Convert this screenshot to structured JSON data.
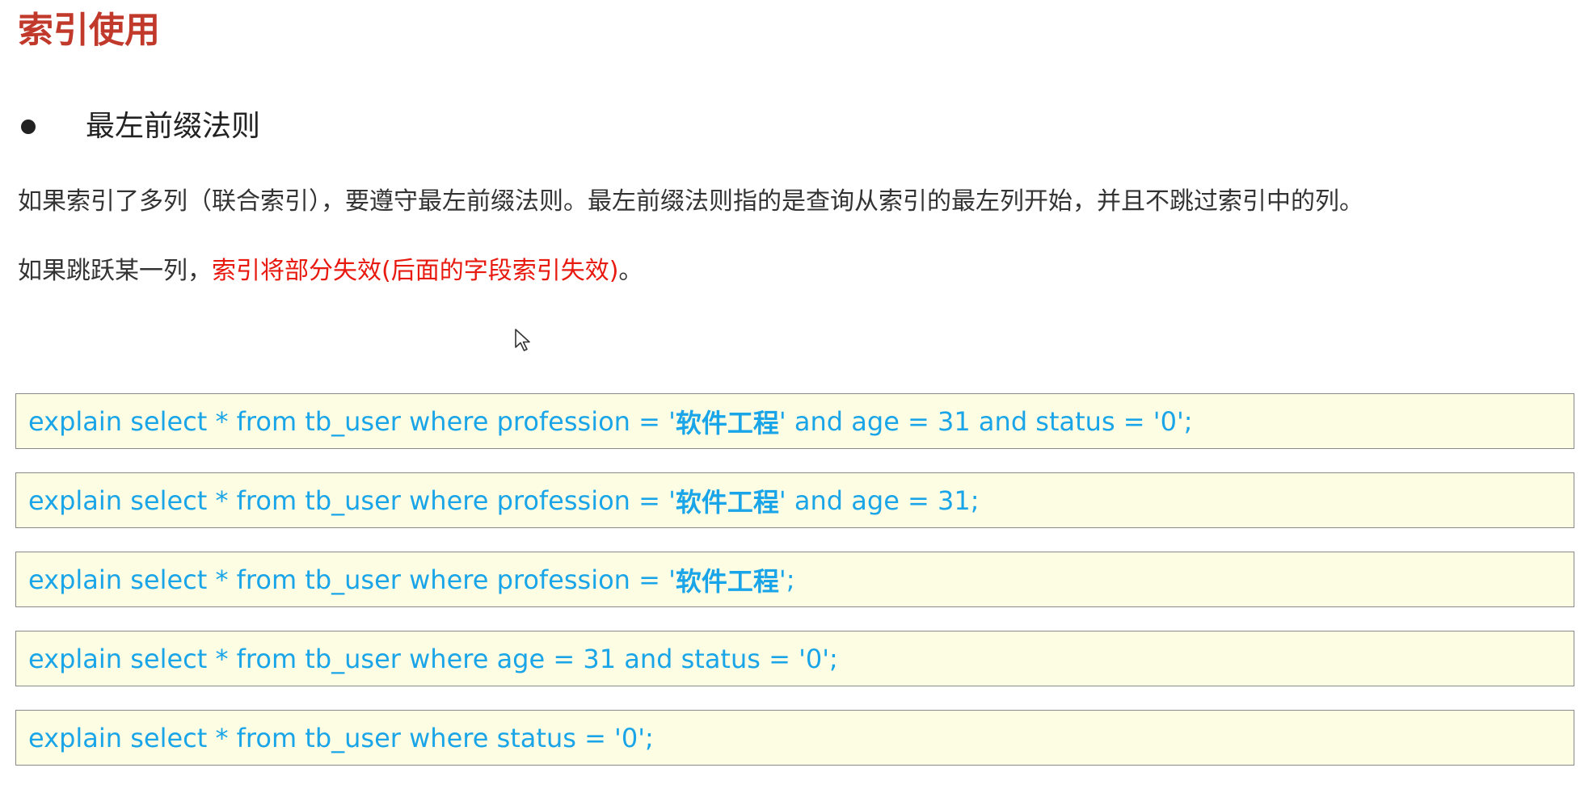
{
  "title": "索引使用",
  "bullet": {
    "text": "最左前缀法则"
  },
  "paragraphs": {
    "p1": "如果索引了多列（联合索引），要遵守最左前缀法则。最左前缀法则指的是查询从索引的最左列开始，并且不跳过索引中的列。",
    "p2_prefix": "如果跳跃某一列，",
    "p2_highlight": "索引将部分失效(后面的字段索引失效)",
    "p2_suffix": "。"
  },
  "queries": [
    {
      "before": "explain select * from tb_user where profession = '",
      "cn": "软件工程",
      "after": "' and age = 31 and status = '0';"
    },
    {
      "before": "explain select * from tb_user where profession = '",
      "cn": "软件工程",
      "after": "' and age = 31;"
    },
    {
      "before": "explain select * from tb_user where profession = '",
      "cn": "软件工程",
      "after": "';"
    },
    {
      "before": "explain select * from tb_user where age = 31 and status = '0';",
      "cn": "",
      "after": ""
    },
    {
      "before": "explain select * from tb_user where status = '0';",
      "cn": "",
      "after": ""
    }
  ],
  "colors": {
    "title": "#c0392b",
    "highlight": "#e8190f",
    "code_text": "#1aa5e8",
    "code_bg": "#fdfde3"
  },
  "icons": {
    "cursor": "mouse-pointer-icon"
  }
}
